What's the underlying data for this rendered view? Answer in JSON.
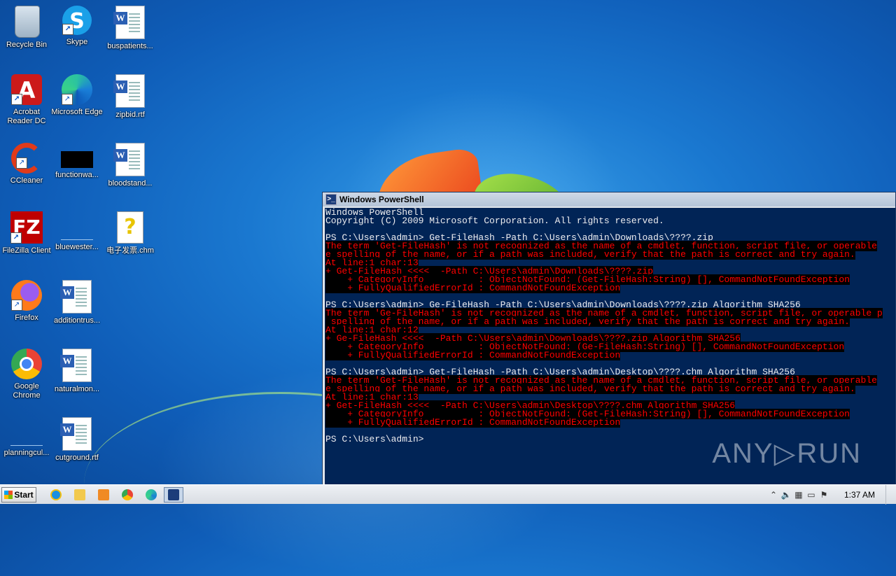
{
  "desktop": {
    "icons": [
      {
        "label": "Recycle Bin"
      },
      {
        "label": "Skype"
      },
      {
        "label": "buspatients..."
      },
      {
        "label": "Acrobat Reader DC"
      },
      {
        "label": "Microsoft Edge"
      },
      {
        "label": "zipbid.rtf"
      },
      {
        "label": "CCleaner"
      },
      {
        "label": "functionwa..."
      },
      {
        "label": "bloodstand..."
      },
      {
        "label": "FileZilla Client"
      },
      {
        "label": "bluewester..."
      },
      {
        "label": "电子发票.chm"
      },
      {
        "label": "Firefox"
      },
      {
        "label": "additiontrus..."
      },
      {
        "label": "Google Chrome"
      },
      {
        "label": "naturalmon..."
      },
      {
        "label": "planningcul..."
      },
      {
        "label": "cutground.rtf"
      }
    ]
  },
  "powershell": {
    "title": "Windows PowerShell",
    "lines": [
      {
        "text": "Windows PowerShell",
        "err": false
      },
      {
        "text": "Copyright (C) 2009 Microsoft Corporation. All rights reserved.",
        "err": false
      },
      {
        "text": "",
        "err": false
      },
      {
        "text": "PS C:\\Users\\admin> Get-FileHash -Path C:\\Users\\admin\\Downloads\\????.zip",
        "err": false
      },
      {
        "text": "The term 'Get-FileHash' is not recognized as the name of a cmdlet, function, script file, or operable",
        "err": true
      },
      {
        "text": "e spelling of the name, or if a path was included, verify that the path is correct and try again.",
        "err": true
      },
      {
        "text": "At line:1 char:13",
        "err": true
      },
      {
        "text": "+ Get-FileHash <<<<  -Path C:\\Users\\admin\\Downloads\\????.zip",
        "err": true
      },
      {
        "text": "    + CategoryInfo          : ObjectNotFound: (Get-FileHash:String) [], CommandNotFoundException",
        "err": true
      },
      {
        "text": "    + FullyQualifiedErrorId : CommandNotFoundException",
        "err": true
      },
      {
        "text": "",
        "err": false
      },
      {
        "text": "PS C:\\Users\\admin> Ge-FileHash -Path C:\\Users\\admin\\Downloads\\????.zip Algorithm SHA256",
        "err": false
      },
      {
        "text": "The term 'Ge-FileHash' is not recognized as the name of a cmdlet, function, script file, or operable p",
        "err": true
      },
      {
        "text": " spelling of the name, or if a path was included, verify that the path is correct and try again.",
        "err": true
      },
      {
        "text": "At line:1 char:12",
        "err": true
      },
      {
        "text": "+ Ge-FileHash <<<<  -Path C:\\Users\\admin\\Downloads\\????.zip Algorithm SHA256",
        "err": true
      },
      {
        "text": "    + CategoryInfo          : ObjectNotFound: (Ge-FileHash:String) [], CommandNotFoundException",
        "err": true
      },
      {
        "text": "    + FullyQualifiedErrorId : CommandNotFoundException",
        "err": true
      },
      {
        "text": "",
        "err": false
      },
      {
        "text": "PS C:\\Users\\admin> Get-FileHash -Path C:\\Users\\admin\\Desktop\\????.chm Algorithm SHA256",
        "err": false
      },
      {
        "text": "The term 'Get-FileHash' is not recognized as the name of a cmdlet, function, script file, or operable",
        "err": true
      },
      {
        "text": "e spelling of the name, or if a path was included, verify that the path is correct and try again.",
        "err": true
      },
      {
        "text": "At line:1 char:13",
        "err": true
      },
      {
        "text": "+ Get-FileHash <<<<  -Path C:\\Users\\admin\\Desktop\\????.chm Algorithm SHA256",
        "err": true
      },
      {
        "text": "    + CategoryInfo          : ObjectNotFound: (Get-FileHash:String) [], CommandNotFoundException",
        "err": true
      },
      {
        "text": "    + FullyQualifiedErrorId : CommandNotFoundException",
        "err": true
      },
      {
        "text": "",
        "err": false
      },
      {
        "text": "PS C:\\Users\\admin>",
        "err": false
      }
    ]
  },
  "watermark": "ANY▷RUN",
  "taskbar": {
    "start_label": "Start",
    "clock": "1:37 AM"
  },
  "colors": {
    "console_bg": "#012456",
    "error_fg": "#ff0000",
    "error_bg": "#000000"
  }
}
